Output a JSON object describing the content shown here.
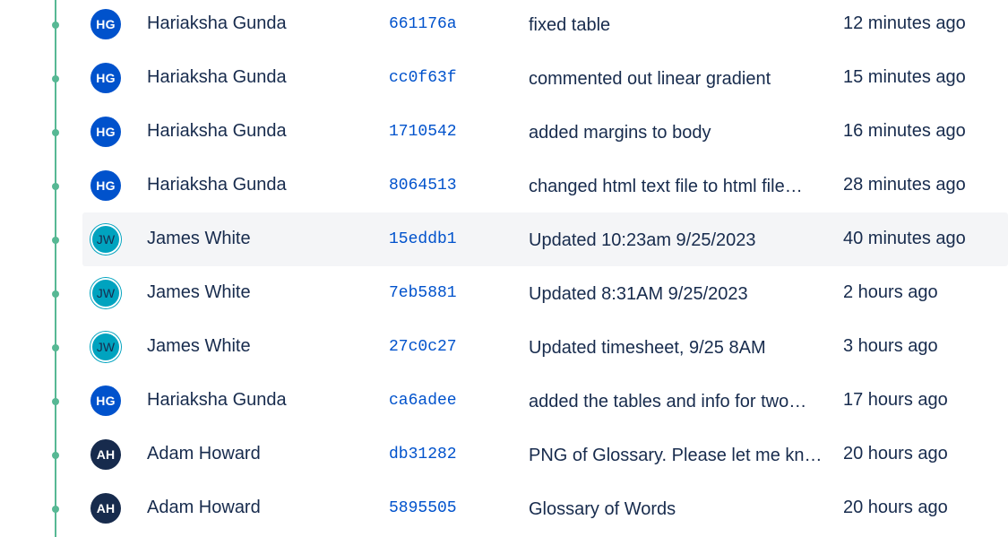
{
  "colors": {
    "graph_line": "#57b894",
    "hash_link": "#0052cc",
    "text": "#172b4d",
    "highlight_row": "#f4f5f7",
    "avatar_hg": "#0052cc",
    "avatar_jw": "#00a3bf",
    "avatar_ah": "#172b4d"
  },
  "commits": [
    {
      "initials": "HG",
      "author": "Hariaksha Gunda",
      "hash": "661176a",
      "message": "fixed table",
      "time": "12 minutes ago"
    },
    {
      "initials": "HG",
      "author": "Hariaksha Gunda",
      "hash": "cc0f63f",
      "message": "commented out linear gradient",
      "time": "15 minutes ago"
    },
    {
      "initials": "HG",
      "author": "Hariaksha Gunda",
      "hash": "1710542",
      "message": "added margins to body",
      "time": "16 minutes ago"
    },
    {
      "initials": "HG",
      "author": "Hariaksha Gunda",
      "hash": "8064513",
      "message": "changed html text file to html file…",
      "time": "28 minutes ago"
    },
    {
      "initials": "JW",
      "author": "James White",
      "hash": "15eddb1",
      "message": "Updated 10:23am 9/25/2023",
      "time": "40 minutes ago"
    },
    {
      "initials": "JW",
      "author": "James White",
      "hash": "7eb5881",
      "message": "Updated 8:31AM 9/25/2023",
      "time": "2 hours ago"
    },
    {
      "initials": "JW",
      "author": "James White",
      "hash": "27c0c27",
      "message": "Updated timesheet, 9/25 8AM",
      "time": "3 hours ago"
    },
    {
      "initials": "HG",
      "author": "Hariaksha Gunda",
      "hash": "ca6adee",
      "message": "added the tables and info for two…",
      "time": "17 hours ago"
    },
    {
      "initials": "AH",
      "author": "Adam Howard",
      "hash": "db31282",
      "message": "PNG of Glossary. Please let me kn…",
      "time": "20 hours ago"
    },
    {
      "initials": "AH",
      "author": "Adam Howard",
      "hash": "5895505",
      "message": "Glossary of Words",
      "time": "20 hours ago"
    }
  ]
}
